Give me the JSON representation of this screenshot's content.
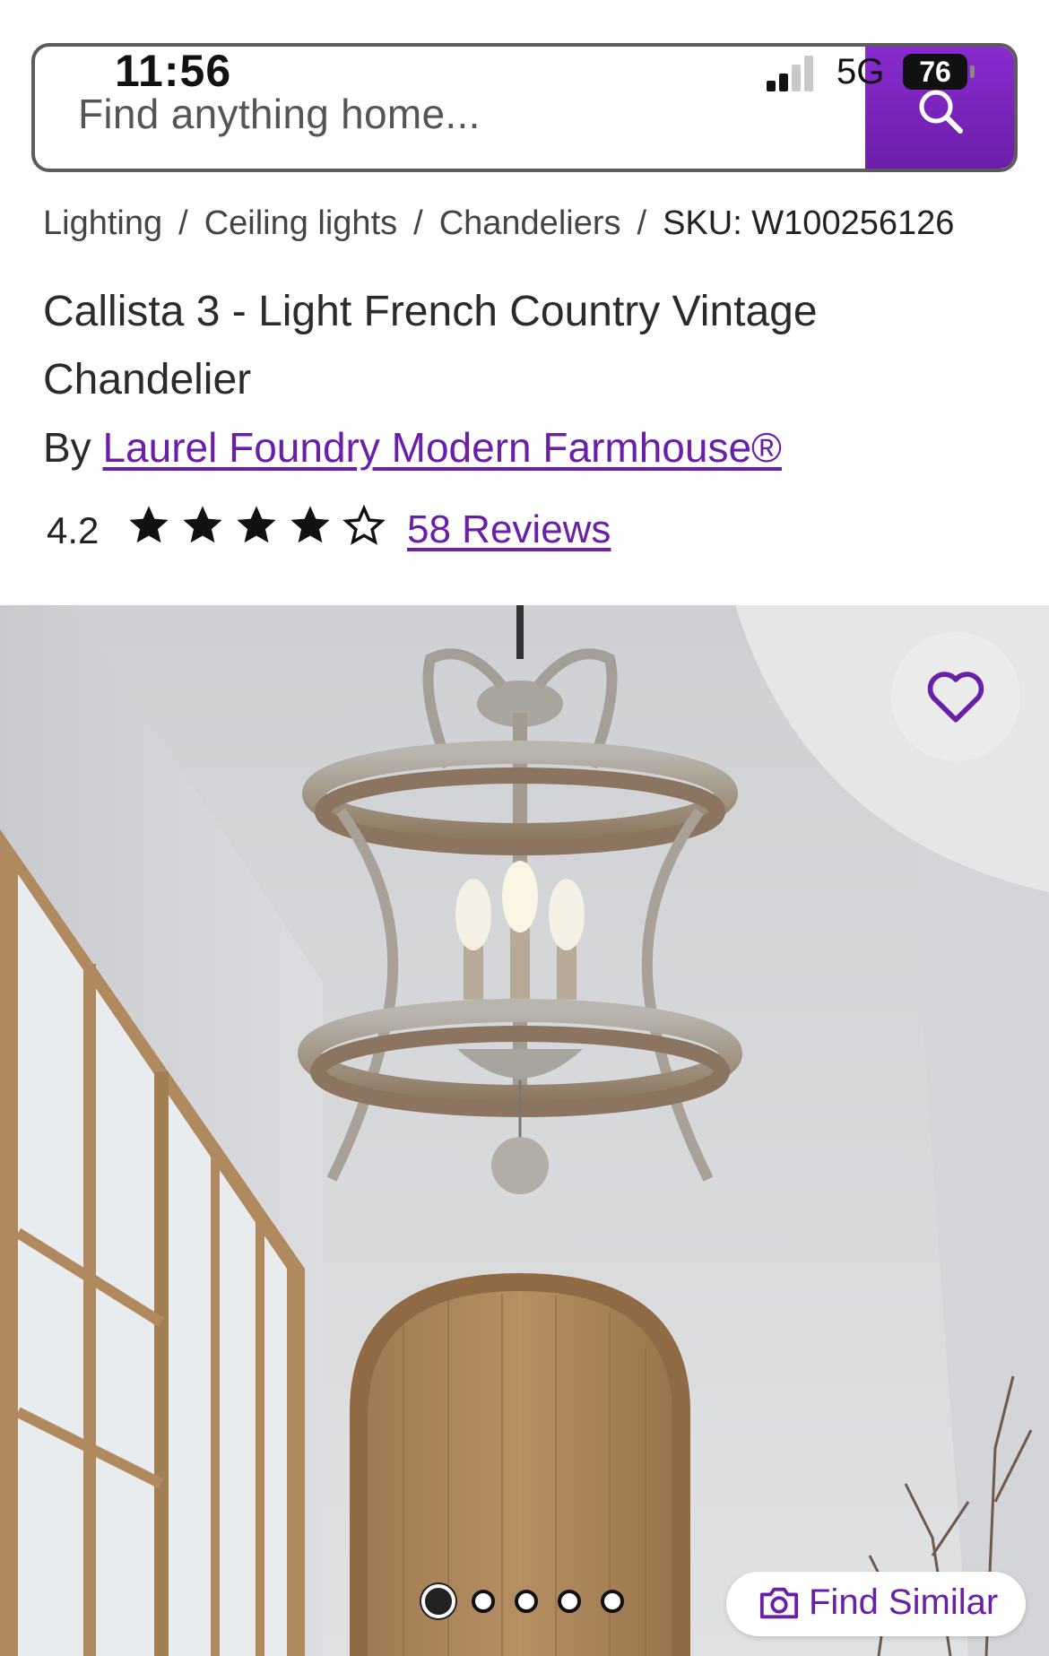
{
  "status_bar": {
    "time": "11:56",
    "network": "5G",
    "battery": "76"
  },
  "search": {
    "placeholder": "Find anything home...",
    "icon": "search-icon"
  },
  "breadcrumb": {
    "items": [
      "Lighting",
      "Ceiling lights",
      "Chandeliers"
    ],
    "separator": "/",
    "sku": "SKU: W100256126"
  },
  "product": {
    "title": "Callista 3 - Light French Country Vintage Chandelier",
    "by_label": "By",
    "brand": "Laurel Foundry Modern Farmhouse®",
    "rating": "4.2",
    "rating_value": 4.2,
    "stars_filled": 4,
    "stars_total": 5,
    "reviews_label": "58 Reviews"
  },
  "gallery": {
    "image_count": 5,
    "active_index": 0,
    "favorite_icon": "heart-outline-icon",
    "find_similar_label": "Find Similar",
    "find_similar_icon": "camera-icon"
  },
  "colors": {
    "brand_purple": "#6a1fa8",
    "search_button": "#7b26bd",
    "text": "#2b2b2b"
  }
}
